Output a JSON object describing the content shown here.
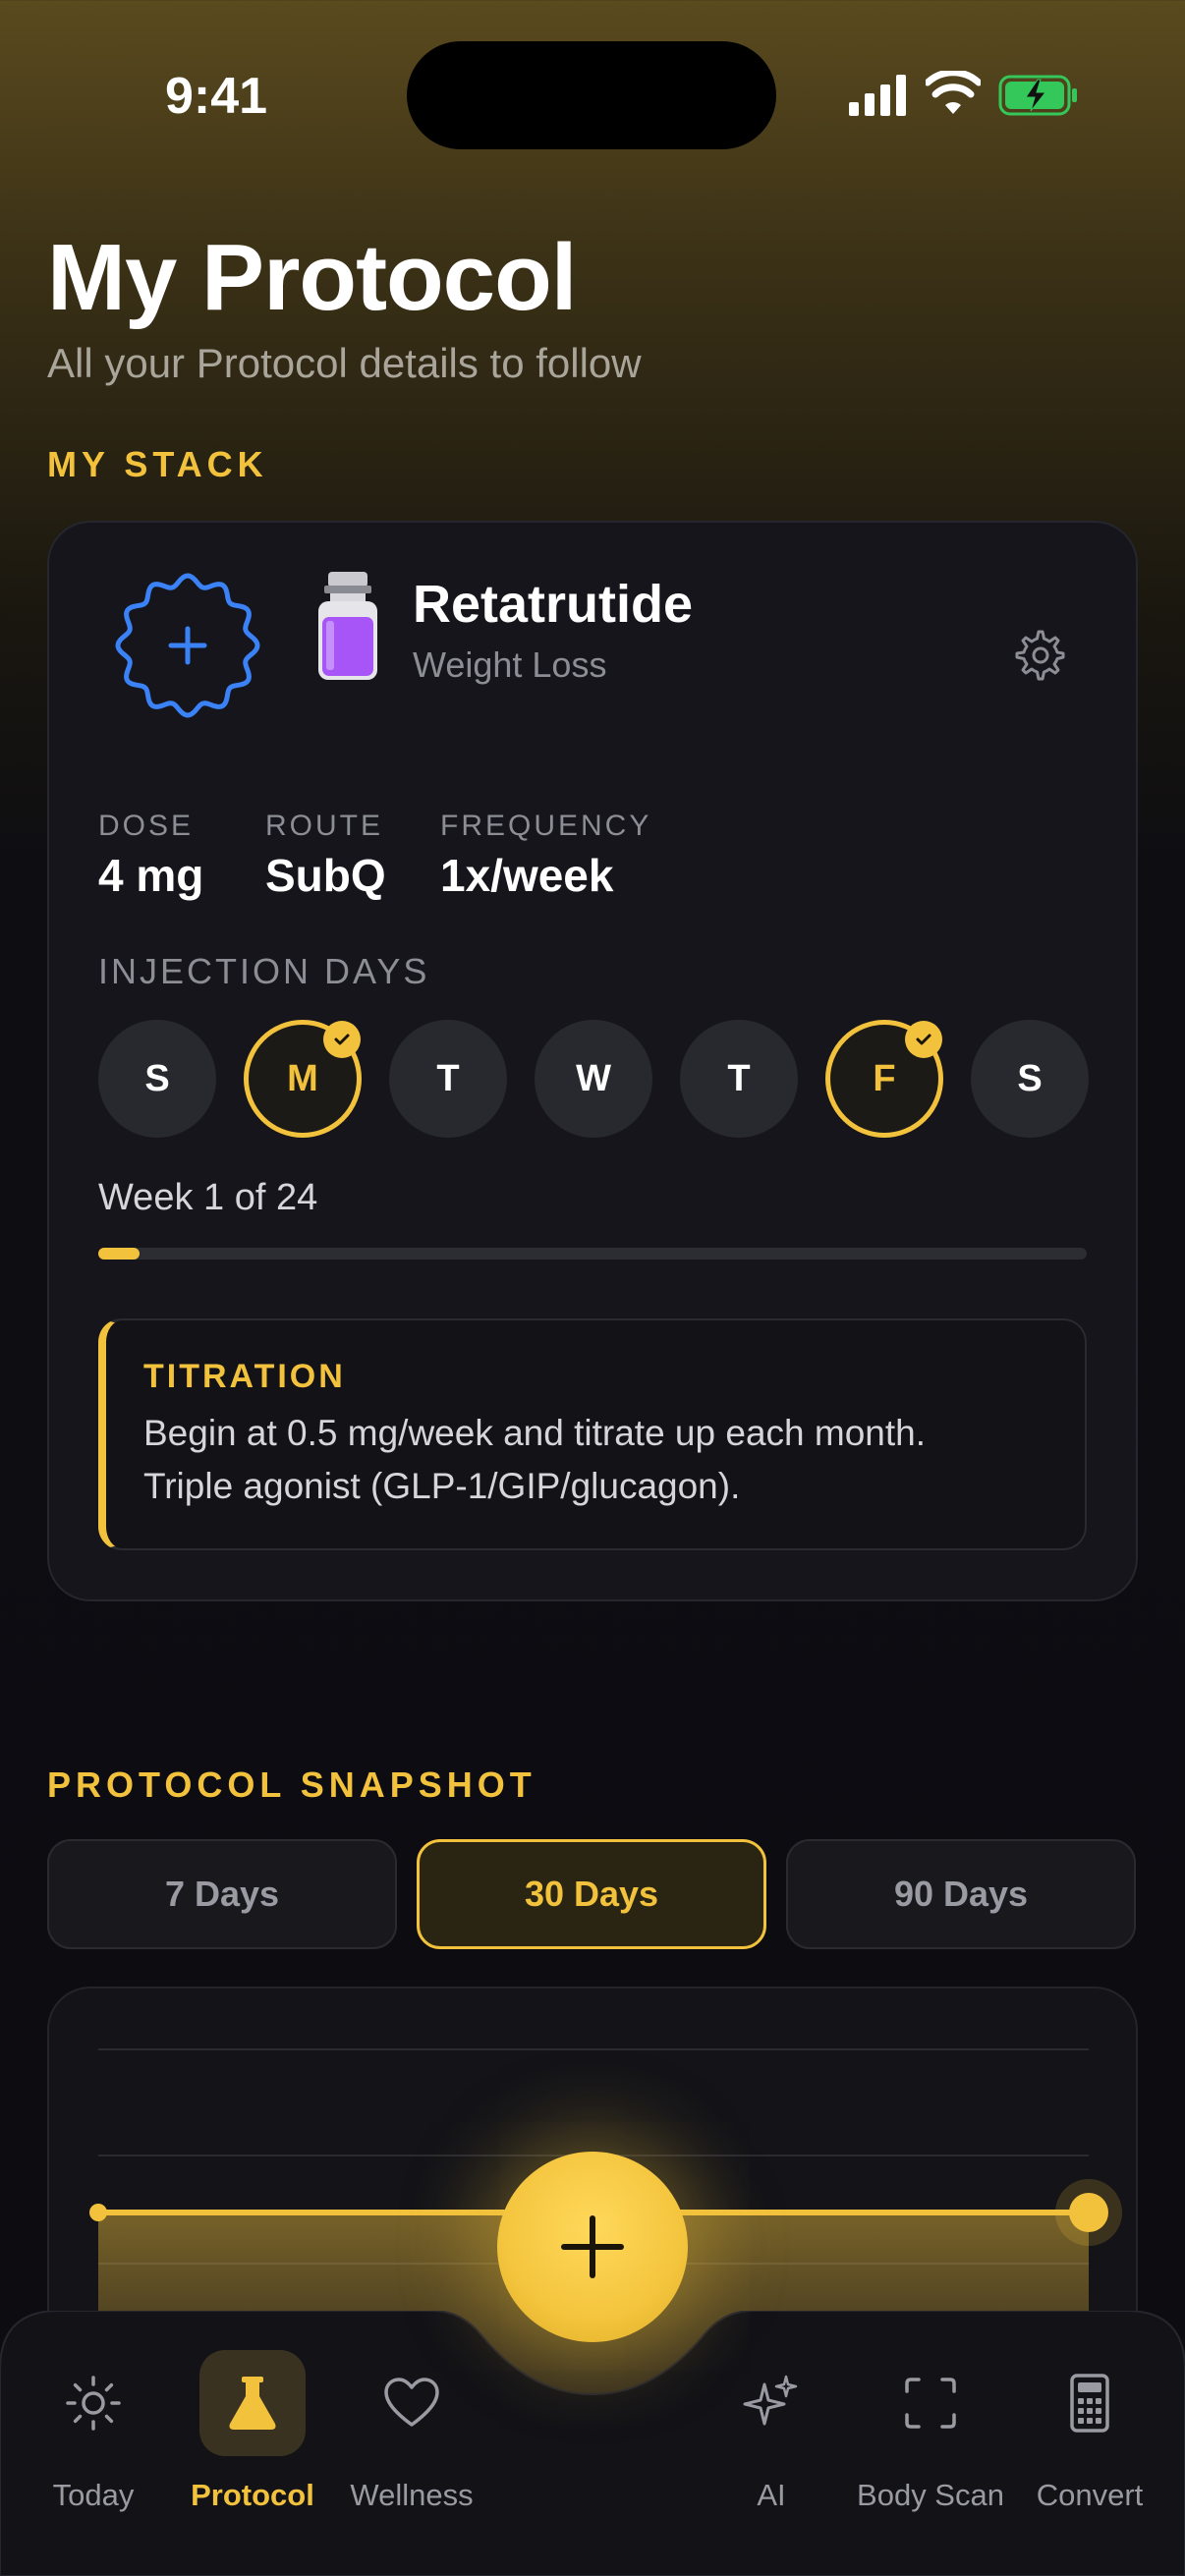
{
  "status_bar": {
    "time": "9:41"
  },
  "header": {
    "title": "My Protocol",
    "subtitle": "All your Protocol details to follow"
  },
  "my_stack": {
    "section_label": "MY STACK",
    "peptide": {
      "name": "Retatrutide",
      "category": "Weight Loss",
      "vial_color": "#a855f7"
    },
    "stats": [
      {
        "label": "DOSE",
        "value": "4 mg"
      },
      {
        "label": "ROUTE",
        "value": "SubQ"
      },
      {
        "label": "FREQUENCY",
        "value": "1x/week"
      }
    ],
    "injection_days_label": "INJECTION DAYS",
    "days": [
      {
        "letter": "S",
        "selected": false
      },
      {
        "letter": "M",
        "selected": true
      },
      {
        "letter": "T",
        "selected": false
      },
      {
        "letter": "W",
        "selected": false
      },
      {
        "letter": "T",
        "selected": false
      },
      {
        "letter": "F",
        "selected": true
      },
      {
        "letter": "S",
        "selected": false
      }
    ],
    "week_label": "Week 1 of 24",
    "week_progress": 0.042,
    "titration": {
      "title": "TITRATION",
      "line1": "Begin at 0.5 mg/week and titrate up each month.",
      "line2": "Triple agonist (GLP-1/GIP/glucagon)."
    }
  },
  "snapshot": {
    "section_label": "PROTOCOL SNAPSHOT",
    "ranges": [
      {
        "label": "7 Days",
        "selected": false
      },
      {
        "label": "30 Days",
        "selected": true
      },
      {
        "label": "90 Days",
        "selected": false
      }
    ]
  },
  "tab_bar": {
    "items": [
      {
        "label": "Today",
        "icon": "sun-icon",
        "active": false
      },
      {
        "label": "Protocol",
        "icon": "flask-icon",
        "active": true
      },
      {
        "label": "Wellness",
        "icon": "heart-icon",
        "active": false
      },
      {
        "label": "AI",
        "icon": "sparkles-icon",
        "active": false
      },
      {
        "label": "Body Scan",
        "icon": "scan-frame-icon",
        "active": false
      },
      {
        "label": "Convert",
        "icon": "calculator-icon",
        "active": false
      }
    ],
    "fab_icon": "plus-icon"
  },
  "colors": {
    "accent": "#f2c23d",
    "badge_blue": "#3b82f6",
    "card_bg": "#15151b"
  }
}
